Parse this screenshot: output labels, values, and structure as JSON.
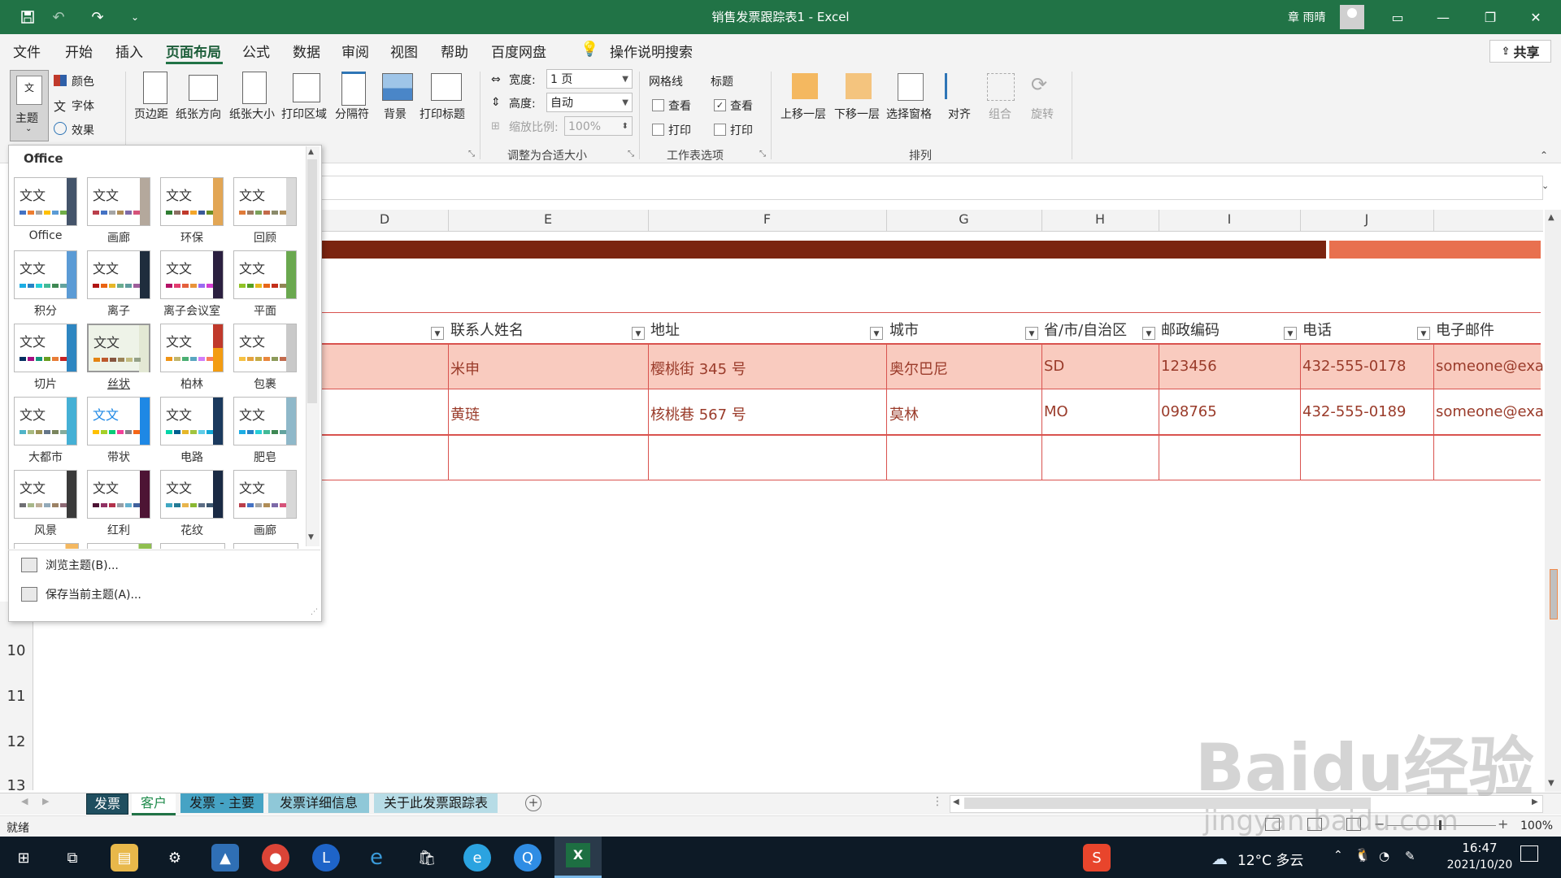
{
  "titlebar": {
    "title": "销售发票跟踪表1  -  Excel",
    "user": "章 雨晴",
    "save_icon": "save-icon",
    "undo_icon": "undo-icon",
    "redo_icon": "redo-icon"
  },
  "menu": {
    "items": [
      "文件",
      "开始",
      "插入",
      "页面布局",
      "公式",
      "数据",
      "审阅",
      "视图",
      "帮助",
      "百度网盘",
      "操作说明搜索"
    ],
    "active": "页面布局",
    "share": "共享"
  },
  "ribbon": {
    "theme": "主题",
    "colors": "颜色",
    "fonts": "字体",
    "effects": "效果",
    "margins": "页边距",
    "orientation": "纸张方向",
    "size": "纸张大小",
    "print_area": "打印区域",
    "breaks": "分隔符",
    "background": "背景",
    "print_titles": "打印标题",
    "width_label": "宽度:",
    "width_value": "1 页",
    "height_label": "高度:",
    "height_value": "自动",
    "scale_label": "缩放比例:",
    "scale_value": "100%",
    "scale_group": "调整为合适大小",
    "gridlines": "网格线",
    "headings": "标题",
    "view": "查看",
    "print": "打印",
    "sheet_options_group": "工作表选项",
    "bring_forward": "上移一层",
    "send_backward": "下移一层",
    "selection_pane": "选择窗格",
    "align": "对齐",
    "group": "组合",
    "rotate": "旋转",
    "arrange_group": "排列"
  },
  "gallery": {
    "header": "Office",
    "wenzi": "文文",
    "themes": [
      "Office",
      "画廊",
      "环保",
      "回顾",
      "积分",
      "离子",
      "离子会议室",
      "平面",
      "切片",
      "丝状",
      "柏林",
      "包裹",
      "大都市",
      "带状",
      "电路",
      "肥皂",
      "风景",
      "红利",
      "花纹",
      "画廊"
    ],
    "browse": "浏览主题(B)...",
    "save": "保存当前主题(A)..."
  },
  "sheet": {
    "columns": [
      "D",
      "E",
      "F",
      "G",
      "H",
      "I",
      "J"
    ],
    "rows": [
      "10",
      "11",
      "12",
      "13"
    ],
    "headers": [
      "联系人姓名",
      "地址",
      "城市",
      "省/市/自治区",
      "邮政编码",
      "电话",
      "电子邮件"
    ],
    "data": [
      [
        "米申",
        "樱桃街 345 号",
        "奥尔巴尼",
        "SD",
        "123456",
        "432-555-0178",
        "someone@exa"
      ],
      [
        "黄琏",
        "核桃巷 567 号",
        "莫林",
        "MO",
        "098765",
        "432-555-0189",
        "someone@exa"
      ]
    ]
  },
  "tabs": [
    "发票",
    "客户",
    "发票 - 主要",
    "发票详细信息",
    "关于此发票跟踪表"
  ],
  "status": {
    "ready": "就绪",
    "zoom": "100%"
  },
  "taskbar": {
    "weather": "12°C  多云",
    "time": "16:47",
    "date": "2021/10/20"
  },
  "watermark": {
    "logo": "Baidu经验",
    "url": "jingyan.baidu.com"
  },
  "colors": {
    "accent": "#217346",
    "band_dark": "#7b2410",
    "band_light": "#e8704f",
    "row_fill": "#f9cbbf"
  }
}
